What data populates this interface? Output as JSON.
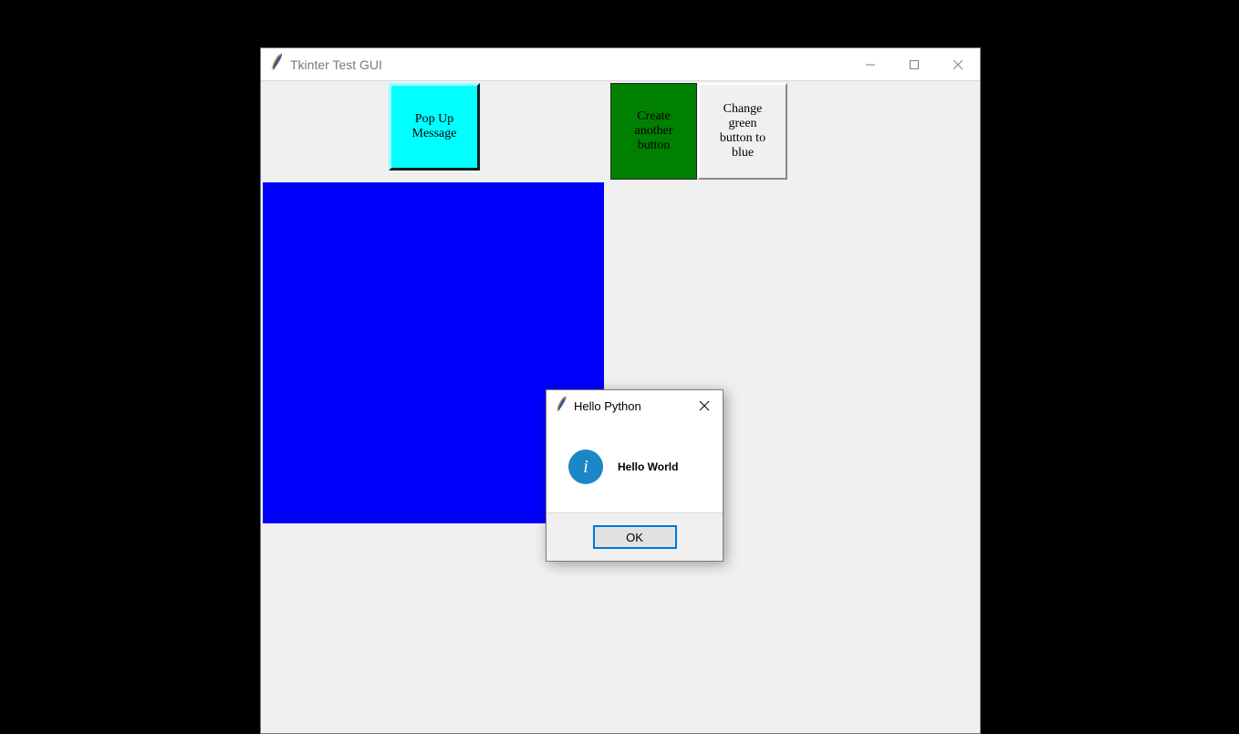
{
  "main_window": {
    "title": "Tkinter Test GUI",
    "buttons": {
      "popup": "Pop Up\nMessage",
      "create": "Create\nanother\nbutton",
      "change": "Change\ngreen\nbutton to\nblue"
    }
  },
  "dialog": {
    "title": "Hello Python",
    "message": "Hello World",
    "ok_label": "OK",
    "info_glyph": "i"
  }
}
